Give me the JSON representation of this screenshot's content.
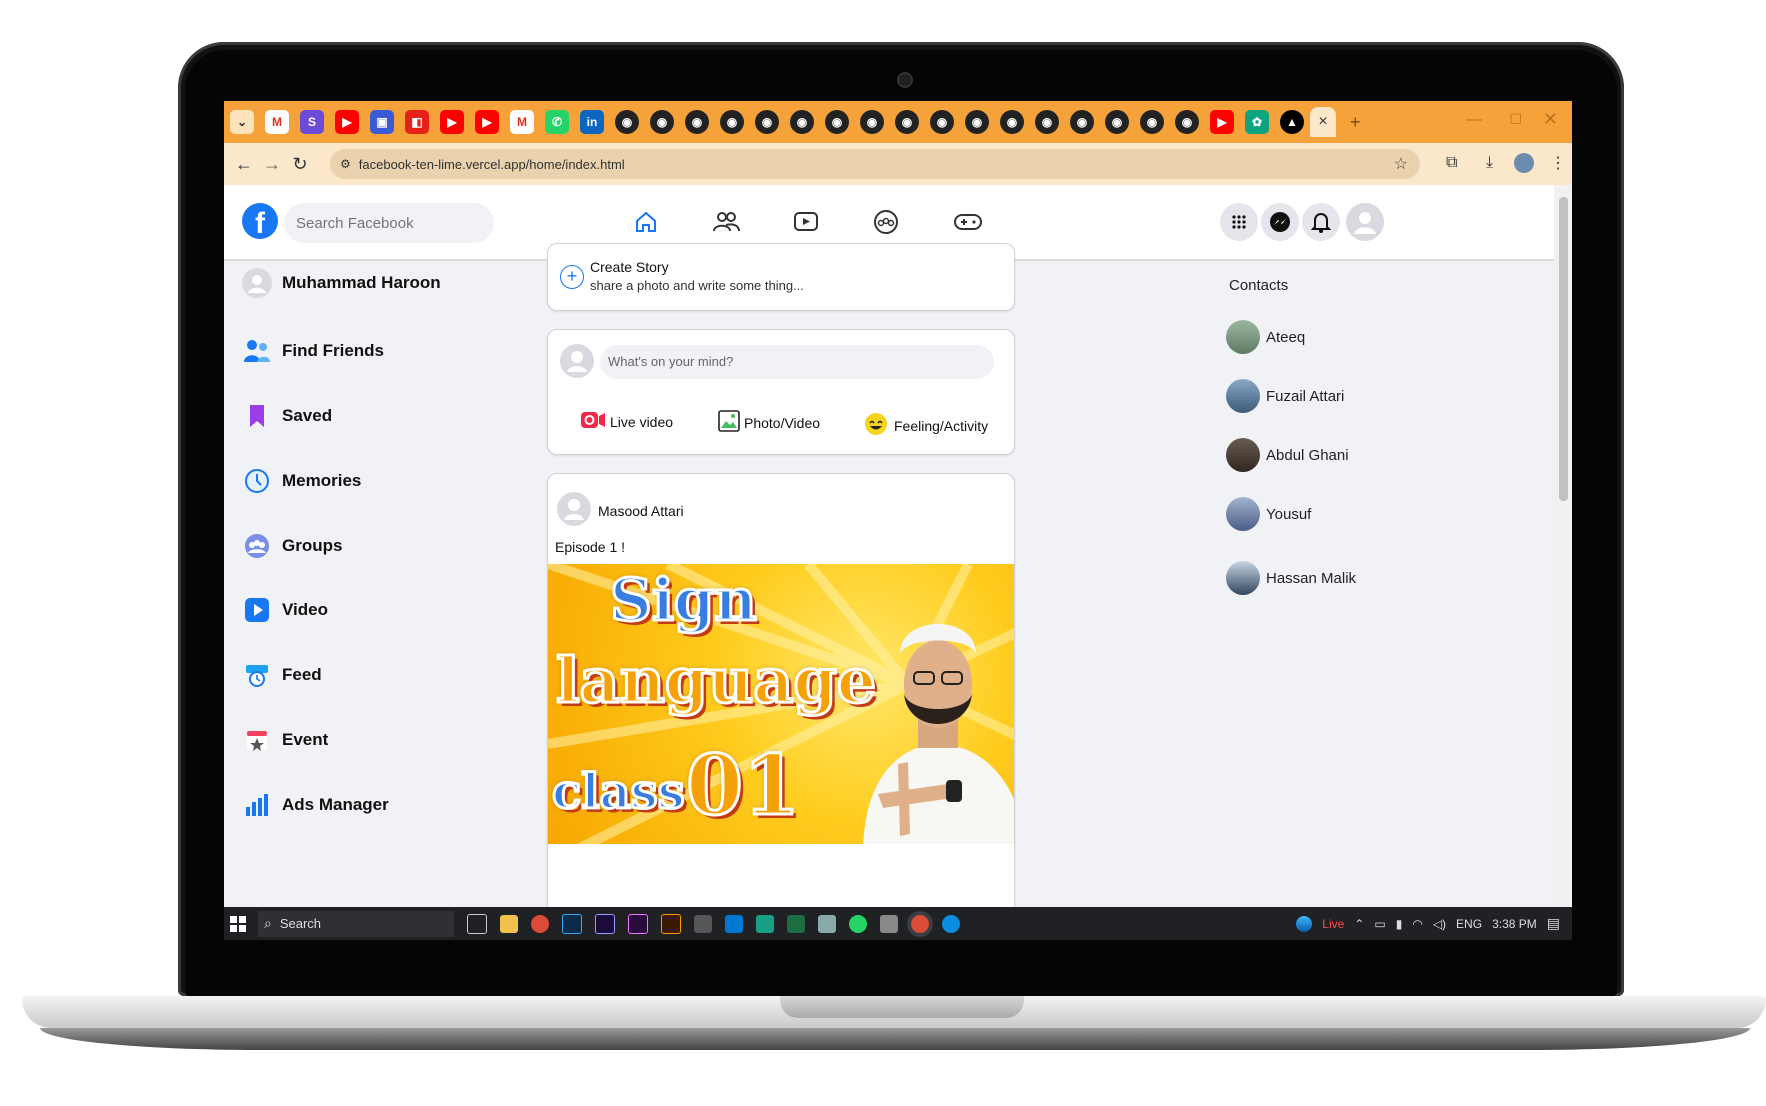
{
  "browser": {
    "url": "facebook-ten-lime.vercel.app/home/index.html",
    "new_tab": "+",
    "close_tab": "×"
  },
  "header": {
    "logo": "f",
    "search_placeholder": "Search Facebook"
  },
  "sidebar": {
    "items": [
      {
        "label": "Muhammad Haroon",
        "icon": "avatar-icon"
      },
      {
        "label": "Find Friends",
        "icon": "friends-icon"
      },
      {
        "label": "Saved",
        "icon": "bookmark-icon"
      },
      {
        "label": "Memories",
        "icon": "clock-icon"
      },
      {
        "label": "Groups",
        "icon": "groups-icon"
      },
      {
        "label": "Video",
        "icon": "play-icon"
      },
      {
        "label": "Feed",
        "icon": "feed-icon"
      },
      {
        "label": "Event",
        "icon": "event-icon"
      },
      {
        "label": "Ads Manager",
        "icon": "bar-chart-icon"
      }
    ]
  },
  "story": {
    "title": "Create Story",
    "subtitle": "share a photo and write some thing..."
  },
  "composer": {
    "placeholder": "What's on your mind?",
    "actions": [
      {
        "label": "Live video",
        "icon": "live-video-icon",
        "color": "#f02849"
      },
      {
        "label": "Photo/Video",
        "icon": "photo-icon",
        "color": "#45bd62"
      },
      {
        "label": "Feeling/Activity",
        "icon": "smiley-icon",
        "color": "#f7b928"
      }
    ]
  },
  "post": {
    "author": "Masood Attari",
    "text": "Episode 1 !",
    "image_text": [
      "Sign",
      "language",
      "class",
      "01"
    ]
  },
  "contacts": {
    "title": "Contacts",
    "list": [
      "Ateeq",
      "Fuzail Attari",
      "Abdul Ghani",
      "Yousuf",
      "Hassan Malik"
    ]
  },
  "taskbar": {
    "search": "Search",
    "live": "Live",
    "lang": "ENG",
    "time": "3:38 PM"
  },
  "colors": {
    "tabbar": "#f6a23a",
    "facebook_blue": "#1877f2",
    "page_bg": "#f0f2f5"
  }
}
